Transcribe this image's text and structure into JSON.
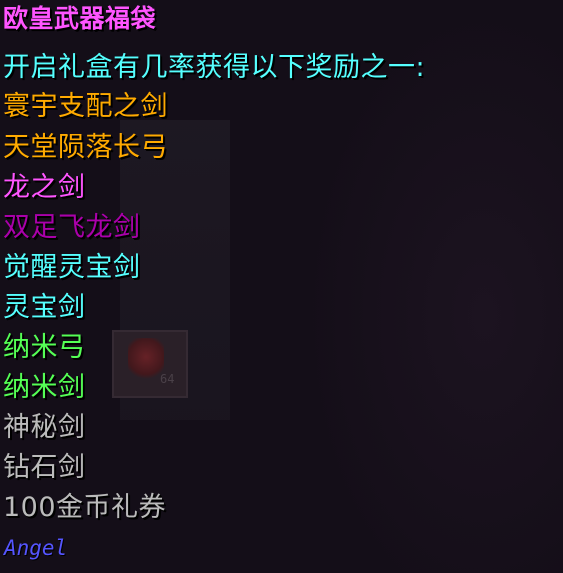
{
  "tooltip": {
    "title": "欧皇武器福袋",
    "intro": "开启礼盒有几率获得以下奖励之一:",
    "rewards": [
      {
        "name": "寰宇支配之剑"
      },
      {
        "name": "天堂陨落长弓"
      },
      {
        "name": "龙之剑"
      },
      {
        "name": "双足飞龙剑"
      },
      {
        "name": "觉醒灵宝剑"
      },
      {
        "name": "灵宝剑"
      },
      {
        "name": "纳米弓"
      },
      {
        "name": "纳米剑"
      },
      {
        "name": "神秘剑"
      },
      {
        "name": "钻石剑"
      },
      {
        "name": "100金币礼券"
      }
    ],
    "signature": "Angel"
  },
  "background": {
    "slot_count": "64"
  },
  "colors": {
    "title": "#ff55ff",
    "intro": "#55ffff",
    "legendary": "#ffaa00",
    "epic_light": "#ff55ff",
    "epic_dark": "#aa00aa",
    "rare": "#55ffff",
    "uncommon": "#55ff55",
    "common": "#bbbbbb",
    "signature": "#5555ff"
  }
}
